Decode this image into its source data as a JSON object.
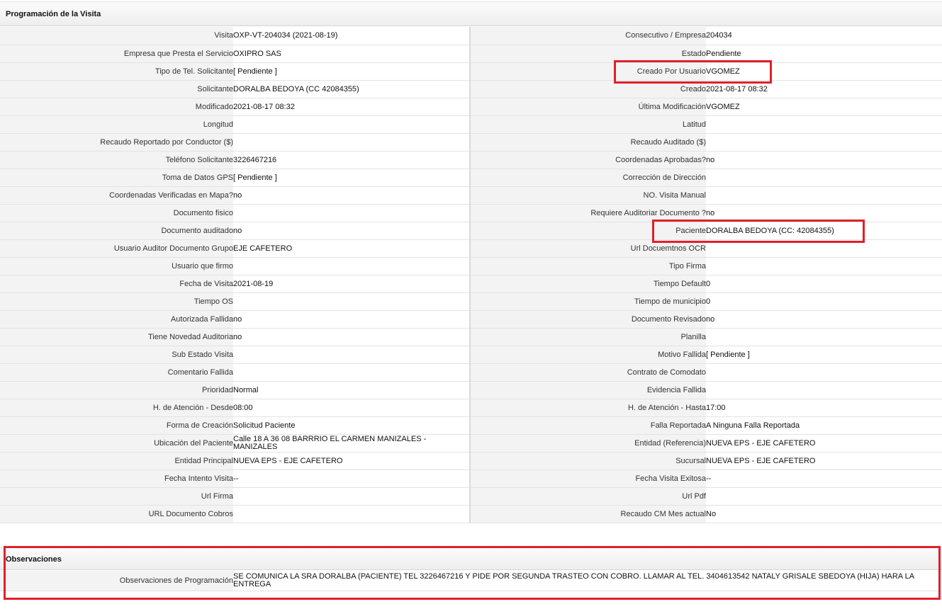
{
  "section_title": "Programación de la Visita",
  "rows": [
    {
      "l1": "Visita",
      "v1": "OXP-VT-204034 (2021-08-19)",
      "l2": "Consecutivo / Empresa",
      "v2": "204034"
    },
    {
      "l1": "Empresa que Presta el Servicio",
      "v1": "OXIPRO SAS",
      "l2": "Estado",
      "v2": "Pendiente"
    },
    {
      "l1": "Tipo de Tel. Solicitante",
      "v1": "[ Pendiente ]",
      "l2": "Creado Por Usuario",
      "v2": "VGOMEZ"
    },
    {
      "l1": "Solicitante",
      "v1": "DORALBA BEDOYA (CC 42084355)",
      "l2": "Creado",
      "v2": "2021-08-17 08:32"
    },
    {
      "l1": "Modificado",
      "v1": "2021-08-17 08:32",
      "l2": "Última Modificación",
      "v2": " VGOMEZ"
    },
    {
      "l1": "Longitud",
      "v1": "",
      "l2": "Latitud",
      "v2": ""
    },
    {
      "l1": "Recaudo Reportado por Conductor ($)",
      "v1": "",
      "l2": "Recaudo Auditado ($)",
      "v2": ""
    },
    {
      "l1": "Teléfono Solicitante",
      "v1": "3226467216",
      "l2": "Coordenadas Aprobadas?",
      "v2": " no"
    },
    {
      "l1": "Toma de Datos GPS",
      "v1": "[ Pendiente ]",
      "l2": "Corrección de Dirección",
      "v2": ""
    },
    {
      "l1": "Coordenadas Verificadas en Mapa?",
      "v1": " no",
      "l2": "NO. Visita Manual",
      "v2": ""
    },
    {
      "l1": "Documento fisico",
      "v1": "",
      "l2": "Requiere Auditoriar Documento ?",
      "v2": " no"
    },
    {
      "l1": "Documento auditado",
      "v1": " no",
      "l2": "Paciente",
      "v2": "DORALBA BEDOYA (CC: 42084355)"
    },
    {
      "l1": "Usuario Auditor Documento Grupo",
      "v1": "EJE CAFETERO",
      "l2": "Url Docuemtnos OCR",
      "v2": ""
    },
    {
      "l1": "Usuario que firmo",
      "v1": "",
      "l2": "Tipo Firma",
      "v2": ""
    },
    {
      "l1": "Fecha de Visita",
      "v1": " 2021-08-19",
      "l2": "Tiempo Default",
      "v2": "0"
    },
    {
      "l1": "Tiempo OS",
      "v1": "",
      "l2": "Tiempo de municipio",
      "v2": "0"
    },
    {
      "l1": "Autorizada Fallida",
      "v1": " no",
      "l2": "Documento Revisado",
      "v2": " no"
    },
    {
      "l1": "Tiene Novedad Auditoria",
      "v1": " no",
      "l2": "Planilla",
      "v2": ""
    },
    {
      "l1": "Sub Estado Visita",
      "v1": "",
      "l2": "Motivo Fallida",
      "v2": "[ Pendiente ]"
    },
    {
      "l1": "Comentario Fallida",
      "v1": "",
      "l2": "Contrato de Comodato",
      "v2": ""
    },
    {
      "l1": "Prioridad",
      "v1": "Normal",
      "l2": "Evidencia Fallida",
      "v2": ""
    },
    {
      "l1": "H. de Atención - Desde",
      "v1": "08:00",
      "l2": "H. de Atención - Hasta",
      "v2": "17:00"
    },
    {
      "l1": "Forma de Creación",
      "v1": "Solicitud Paciente",
      "l2": "Falla Reportada",
      "v2": "A Ninguna Falla Reportada"
    },
    {
      "l1": "Ubicación del Paciente",
      "v1": "Calle 18 A 36 08 BARRRIO EL CARMEN MANIZALES - MANIZALES",
      "l2": "Entidad (Referencia)",
      "v2": "NUEVA EPS - EJE CAFETERO"
    },
    {
      "l1": "Entidad Principal",
      "v1": "NUEVA EPS - EJE CAFETERO",
      "l2": "Sucursal",
      "v2": "NUEVA EPS - EJE CAFETERO"
    },
    {
      "l1": "Fecha Intento Visita",
      "v1": " --",
      "l2": "Fecha Visita Exitosa",
      "v2": " --"
    },
    {
      "l1": "Url Firma",
      "v1": "",
      "l2": "Url Pdf",
      "v2": ""
    },
    {
      "l1": "URL Documento Cobros",
      "v1": "",
      "l2": "Recaudo CM Mes actual",
      "v2": "No"
    }
  ],
  "observaciones": {
    "title": "Observaciones",
    "label": "Observaciones de Programación",
    "value": "  SE COMUNICA LA SRA DORALBA (PACIENTE) TEL 3226467216 Y PIDE POR SEGUNDA TRASTEO CON COBRO. LLAMAR AL TEL. 3404613542 NATALY GRISALE SBEDOYA (HIJA) HARA LA ENTREGA"
  },
  "highlight_color": "#e0202a"
}
